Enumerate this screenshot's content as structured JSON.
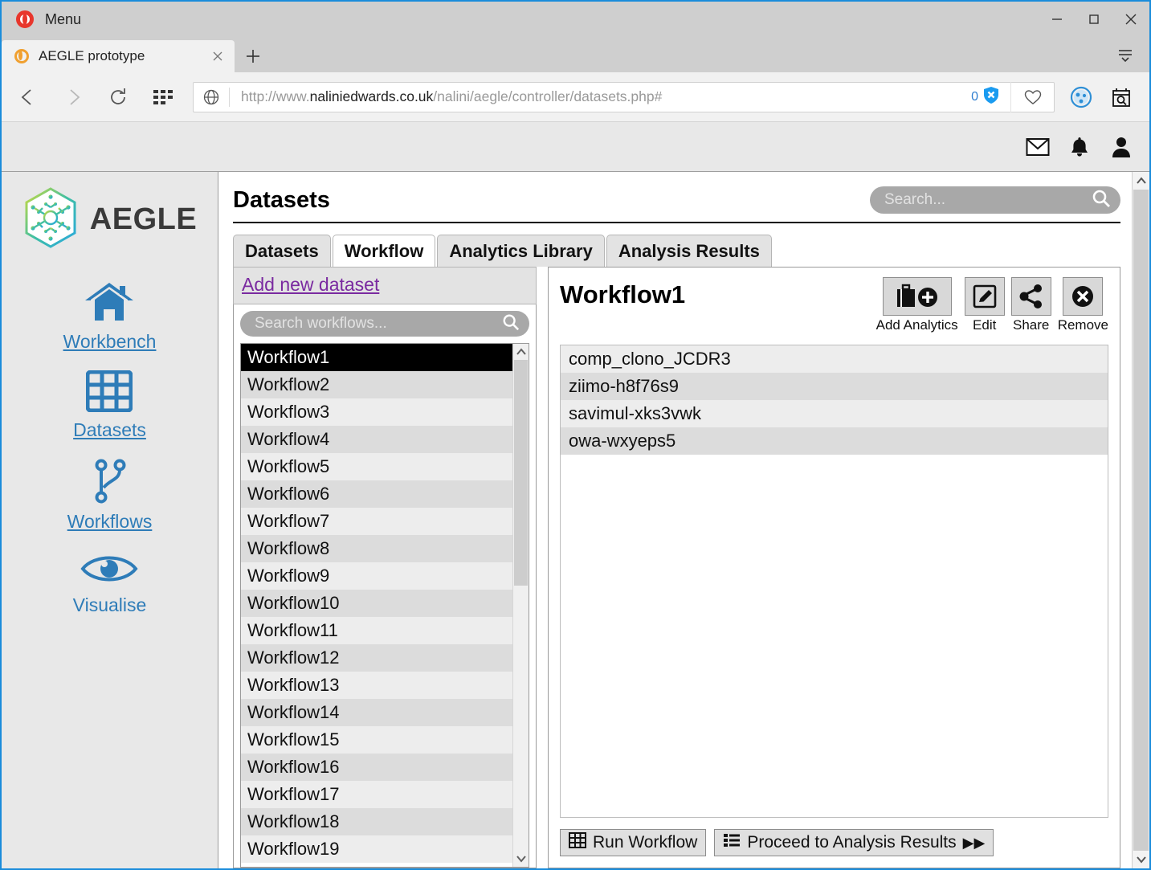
{
  "browser": {
    "menu_label": "Menu",
    "tab_title": "AEGLE prototype",
    "url_prefix": "http://www.",
    "url_domain": "naliniedwards.co.uk",
    "url_path": "/nalini/aegle/controller/datasets.php#",
    "adblock_count": "0",
    "icons": {
      "opera": "opera-logo-icon",
      "back": "back-arrow-icon",
      "forward": "forward-arrow-icon",
      "reload": "reload-icon",
      "speeddial": "speed-dial-grid-icon",
      "globe": "globe-icon",
      "shield": "adblock-shield-icon",
      "heart": "heart-icon",
      "minimize": "minimize-icon",
      "maximize": "maximize-icon",
      "close": "close-icon",
      "menu": "hamburger-menu-icon"
    }
  },
  "app_header": {
    "icons": [
      "mail-icon",
      "bell-icon",
      "user-icon"
    ]
  },
  "sidebar": {
    "brand": "AEGLE",
    "items": [
      {
        "label": "Workbench",
        "icon": "home-icon",
        "underline": true
      },
      {
        "label": "Datasets",
        "icon": "table-icon",
        "underline": true
      },
      {
        "label": "Workflows",
        "icon": "branch-icon",
        "underline": true
      },
      {
        "label": "Visualise",
        "icon": "eye-icon",
        "underline": false
      }
    ]
  },
  "main": {
    "page_title": "Datasets",
    "search": {
      "placeholder": "Search...",
      "value": ""
    },
    "tabs": [
      {
        "label": "Datasets",
        "active": false
      },
      {
        "label": "Workflow",
        "active": true
      },
      {
        "label": "Analytics Library",
        "active": false
      },
      {
        "label": "Analysis Results",
        "active": false
      }
    ]
  },
  "left_pane": {
    "add_new_label": "Add new dataset",
    "search": {
      "placeholder": "Search workflows...",
      "value": ""
    },
    "selected": "Workflow1",
    "items": [
      "Workflow1",
      "Workflow2",
      "Workflow3",
      "Workflow4",
      "Workflow5",
      "Workflow6",
      "Workflow7",
      "Workflow8",
      "Workflow9",
      "Workflow10",
      "Workflow11",
      "Workflow12",
      "Workflow13",
      "Workflow14",
      "Workflow15",
      "Workflow16",
      "Workflow17",
      "Workflow18",
      "Workflow19"
    ]
  },
  "right_pane": {
    "title": "Workflow1",
    "actions": [
      {
        "label": "Add Analytics",
        "icon": "briefcase-plus-icon"
      },
      {
        "label": "Edit",
        "icon": "pencil-square-icon"
      },
      {
        "label": "Share",
        "icon": "share-nodes-icon"
      },
      {
        "label": "Remove",
        "icon": "circle-x-icon"
      }
    ],
    "datasets": [
      "comp_clono_JCDR3",
      "ziimo-h8f76s9",
      "savimul-xks3vwk",
      "owa-wxyeps5"
    ],
    "footer_buttons": [
      {
        "label": "Run Workflow",
        "icon": "table-grid-icon",
        "trailing": ""
      },
      {
        "label": "Proceed to Analysis Results",
        "icon": "list-icon",
        "trailing": "▶▶"
      }
    ]
  },
  "colors": {
    "accent_blue": "#2e7cb8",
    "link_purple": "#7a2aa0",
    "selection_black": "#000000",
    "row_even": "#dcdcdc",
    "row_odd": "#ededed"
  }
}
